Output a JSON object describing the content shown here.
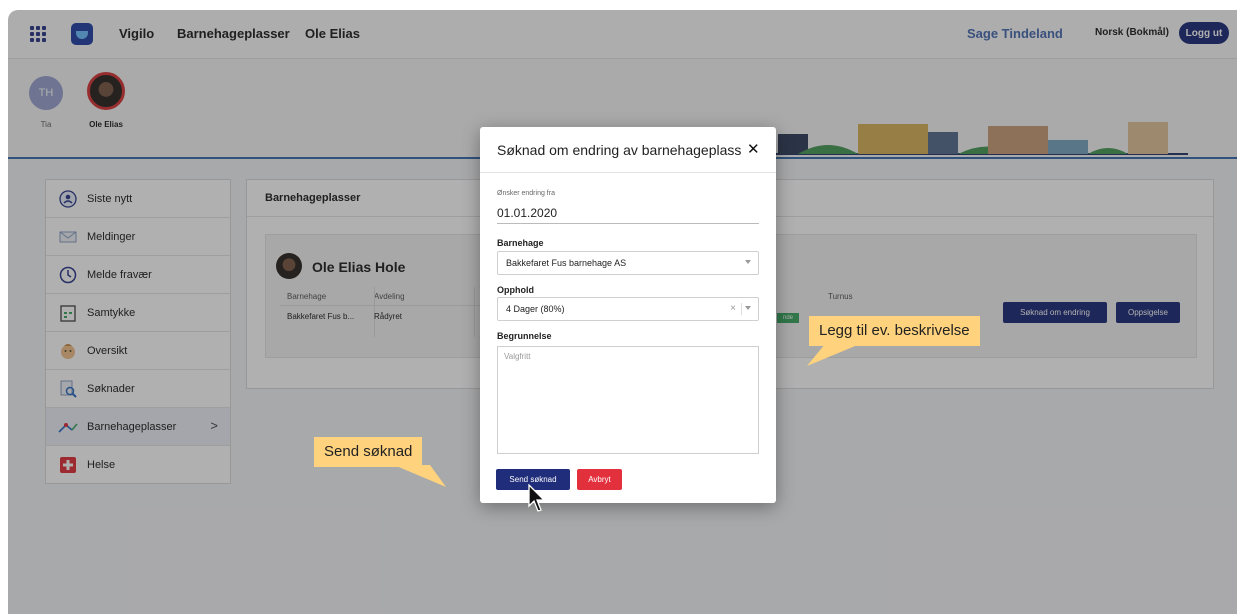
{
  "topbar": {
    "brand": "Vigilo",
    "nav_items": [
      "Barnehageplasser",
      "Ole Elias"
    ],
    "username": "Sage Tindeland",
    "language": "Norsk (Bokmål)",
    "logout_label": "Logg ut"
  },
  "children": [
    {
      "initials": "TH",
      "name": "Tia"
    },
    {
      "initials": "",
      "name": "Ole Elias"
    }
  ],
  "menu": {
    "items": [
      {
        "label": "Siste nytt",
        "icon": "news-icon"
      },
      {
        "label": "Meldinger",
        "icon": "envelope-icon"
      },
      {
        "label": "Melde fravær",
        "icon": "clock-icon"
      },
      {
        "label": "Samtykke",
        "icon": "calendar-icon"
      },
      {
        "label": "Oversikt",
        "icon": "child-icon"
      },
      {
        "label": "Søknader",
        "icon": "document-search-icon"
      },
      {
        "label": "Barnehageplasser",
        "icon": "playground-icon",
        "active": true
      },
      {
        "label": "Helse",
        "icon": "health-icon"
      }
    ]
  },
  "main": {
    "title": "Barnehageplasser",
    "child_name": "Ole Elias Hole",
    "columns": [
      "Barnehage",
      "Avdeling",
      "Turnus"
    ],
    "row": [
      "Bakkefaret Fus b...",
      "Rådyret"
    ],
    "badge_text": "nde",
    "change_button": "Søknad om endring",
    "termination_button": "Oppsigelse"
  },
  "modal": {
    "title": "Søknad om endring av barnehageplass",
    "close_symbol": "✕",
    "date_label": "Ønsker endring fra",
    "date_value": "01.01.2020",
    "kindergarten_label": "Barnehage",
    "kindergarten_value": "Bakkefaret Fus barnehage AS",
    "stay_label": "Opphold",
    "stay_value": "4 Dager (80%)",
    "reason_label": "Begrunnelse",
    "reason_placeholder": "Valgfritt",
    "send_label": "Send søknad",
    "cancel_label": "Avbryt"
  },
  "callouts": {
    "description": "Legg til ev. beskrivelse",
    "send": "Send søknad"
  },
  "colors": {
    "primary": "#1f2d7a",
    "danger": "#e2303c",
    "callout": "#ffd27d",
    "accent_line": "#3b6fb0"
  }
}
